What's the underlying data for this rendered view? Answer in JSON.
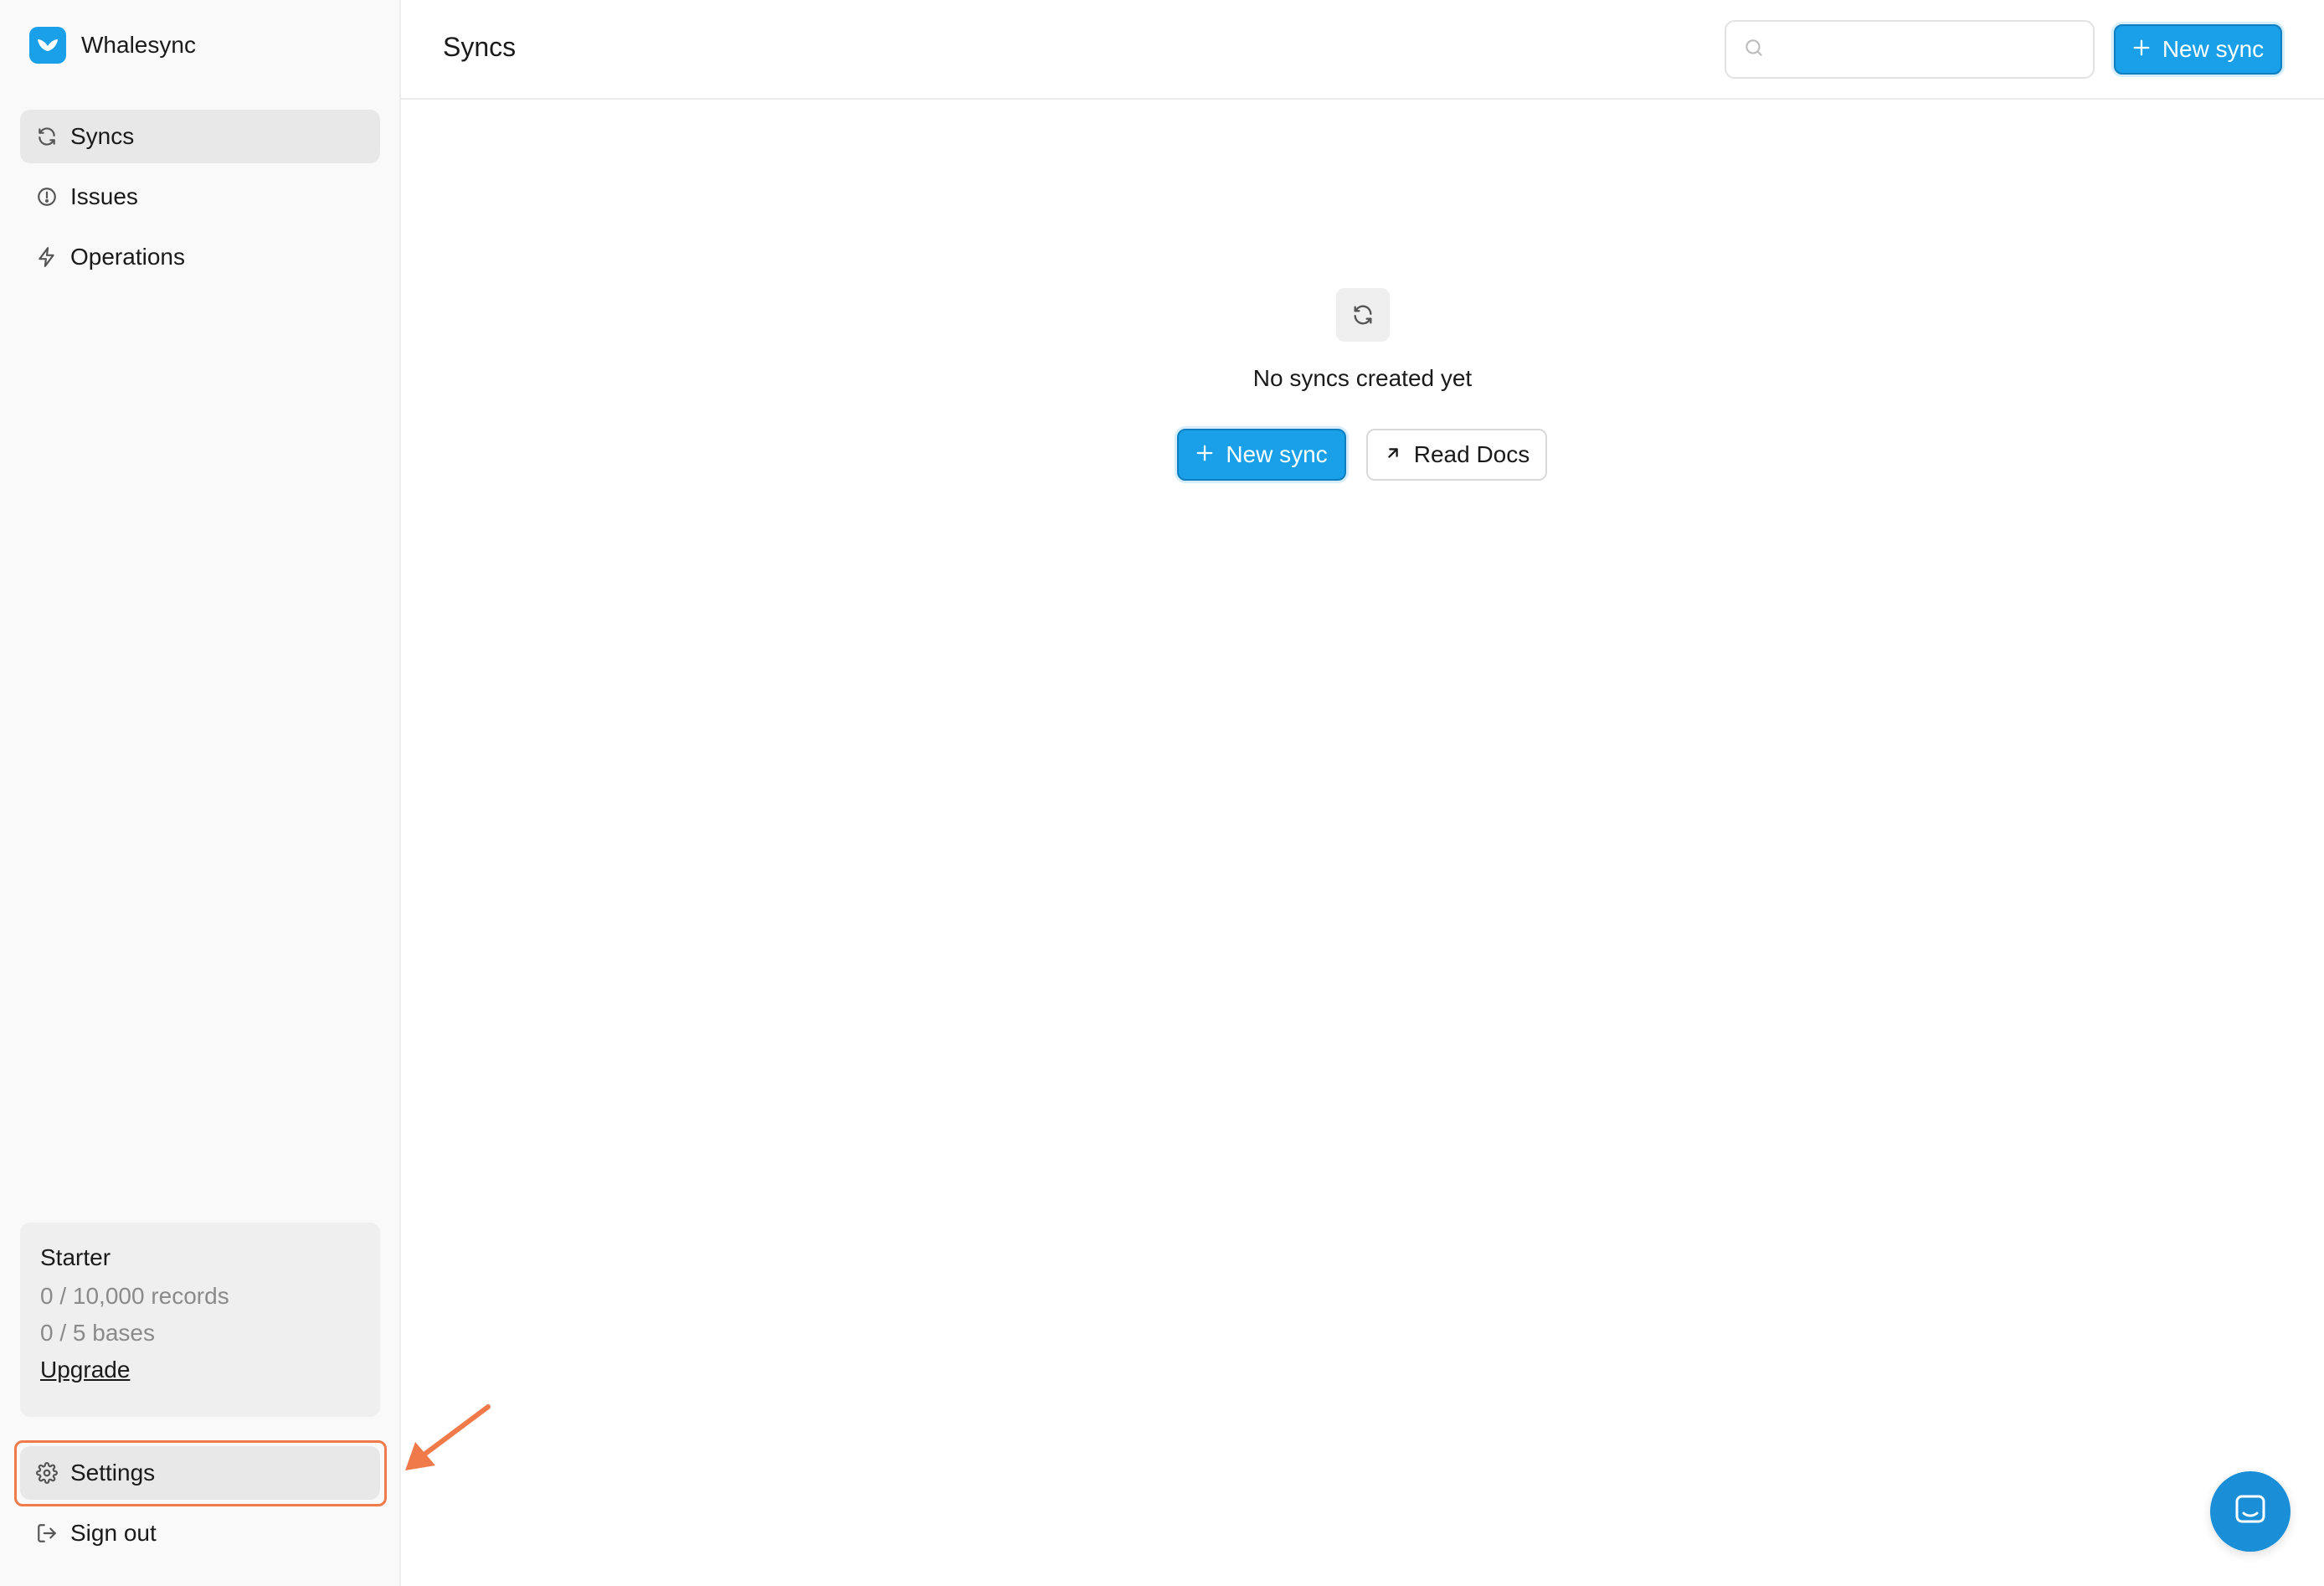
{
  "brand": {
    "name": "Whalesync",
    "icon": "whale-tail-icon",
    "color": "#1aa0e8"
  },
  "sidebar": {
    "items": [
      {
        "label": "Syncs",
        "icon": "sync-icon",
        "active": true
      },
      {
        "label": "Issues",
        "icon": "alert-circle-icon",
        "active": false
      },
      {
        "label": "Operations",
        "icon": "lightning-icon",
        "active": false
      }
    ],
    "plan": {
      "name": "Starter",
      "records": "0 / 10,000 records",
      "bases": "0 / 5 bases",
      "upgrade_label": "Upgrade"
    },
    "bottom_items": [
      {
        "label": "Settings",
        "icon": "gear-icon",
        "highlighted": true
      },
      {
        "label": "Sign out",
        "icon": "sign-out-icon"
      }
    ]
  },
  "header": {
    "title": "Syncs",
    "search": {
      "placeholder": "",
      "value": ""
    },
    "new_sync_label": "New sync"
  },
  "empty_state": {
    "icon": "sync-icon",
    "message": "No syncs created yet",
    "new_sync_label": "New sync",
    "read_docs_label": "Read Docs"
  },
  "colors": {
    "accent": "#1aa0e8",
    "highlight": "#f07a4a"
  }
}
